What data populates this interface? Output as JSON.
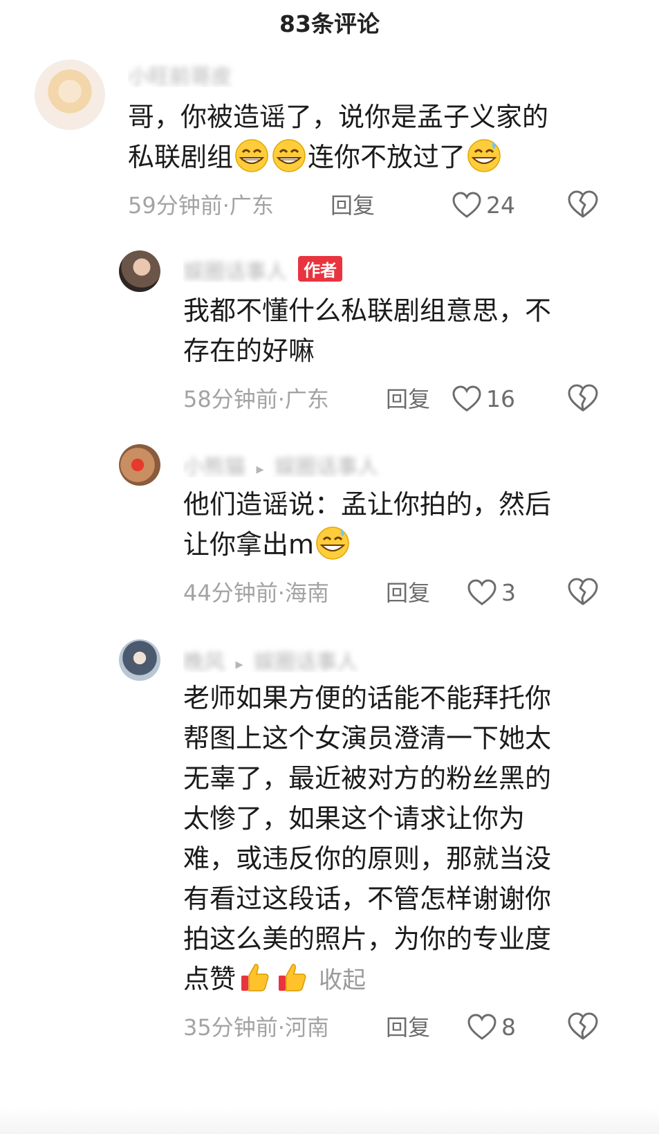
{
  "header": {
    "title": "83条评论"
  },
  "comments": [
    {
      "username": "小旺前哥皮",
      "text_lines": [
        "哥，你被造谣了，说你是孟子义家的",
        "私联剧组",
        "连你不放过了"
      ],
      "time_location": "59分钟前·广东",
      "reply_label": "回复",
      "likes": "24"
    },
    {
      "username": "娱圈话事人",
      "badge": "作者",
      "text_lines": [
        "我都不懂什么私联剧组意思，不",
        "存在的好嘛"
      ],
      "time_location": "58分钟前·广东",
      "reply_label": "回复",
      "likes": "16"
    },
    {
      "username": "小熊猫",
      "reply_to": "娱圈话事人",
      "text_lines": [
        "他们造谣说：孟让你拍的，然后",
        "让你拿出m"
      ],
      "time_location": "44分钟前·海南",
      "reply_label": "回复",
      "likes": "3"
    },
    {
      "username": "晚风",
      "reply_to": "娱圈话事人",
      "text_lines": [
        "老师如果方便的话能不能拜托你",
        "帮图上这个女演员澄清一下她太",
        "无辜了，最近被对方的粉丝黑的",
        "太惨了，如果这个请求让你为",
        "难，或违反你的原则，那就当没",
        "有看过这段话，不管怎样谢谢你",
        "拍这么美的照片，为你的专业度",
        "点赞"
      ],
      "fold_label": "收起",
      "time_location": "35分钟前·河南",
      "reply_label": "回复",
      "likes": "8"
    }
  ],
  "icons": {
    "like": "heart-outline-icon",
    "dislike": "broken-heart-icon",
    "grin": "grinning-face-emoji",
    "sweat": "grinning-face-with-sweat-emoji",
    "thumbs": "thumbs-up-emoji"
  },
  "colors": {
    "badge": "#e8343f",
    "meta": "#a3a3a3",
    "text": "#1b1b1b"
  }
}
